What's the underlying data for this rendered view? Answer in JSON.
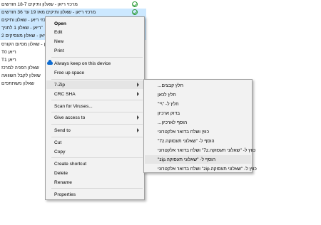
{
  "file_list": {
    "rows": [
      {
        "name": "מרכזי ריאן - שאלון ותיקים 18-7 חודשים",
        "selected": false,
        "synced": true
      },
      {
        "name": "מרכזי ריאן - שאלון ותיקים מאז 19 עד 36 חודשים",
        "selected": true,
        "synced": true
      },
      {
        "name": "מרכזי ריאן - שאלון ותיקים",
        "selected": true,
        "synced": false
      },
      {
        "name": "\"ריאן - שאלון 1 לחניך",
        "selected": true,
        "synced": false
      },
      {
        "name": "ריאן - שאלון מעסיקים 2",
        "selected": true,
        "synced": false
      },
      {
        "name": "ריאן - שאלון מסיום הקורס",
        "selected": false,
        "synced": false
      },
      {
        "name": "T0 ריאן",
        "selected": false,
        "synced": false
      },
      {
        "name": "T1 ריאן",
        "selected": false,
        "synced": false
      },
      {
        "name": "שאלון הפניה למרכז",
        "selected": false,
        "synced": false
      },
      {
        "name": "שאלון לקבל השוואה",
        "selected": false,
        "synced": false
      },
      {
        "name": "שאלון משתתפים",
        "selected": false,
        "synced": false
      }
    ]
  },
  "context_menu": {
    "open": "Open",
    "edit": "Edit",
    "new": "New",
    "print": "Print",
    "always_keep": "Always keep on this device",
    "free_up_space": "Free up space",
    "seven_zip": "7-Zip",
    "crc_sha": "CRC SHA",
    "scan_viruses": "Scan for Viruses...",
    "give_access": "Give access to",
    "send_to": "Send to",
    "cut": "Cut",
    "copy": "Copy",
    "create_shortcut": "Create shortcut",
    "delete": "Delete",
    "rename": "Rename",
    "properties": "Properties"
  },
  "submenu_7zip": {
    "items": [
      "חלץ קבצים...",
      "חלץ לכאן",
      "חלץ ל- \"\\*\"",
      "בדוק ארכיון",
      "הוסף לארכיון...",
      "כווץ ושלח בדואר אלקטרוני",
      "הוסף ל- \"שאלוני תעסוקה.7z\"",
      "כווץ ל- \"שאלוני תעסוקה.7z\" ושלח בדואר אלקטרוני",
      "הוסף ל- \"שאלוני תעסוקה.zip\"",
      "כווץ ל- \"שאלוני תעסוקה.zip\" ושלח בדואר אלקטרוני"
    ],
    "hovered_index": 8
  },
  "colors": {
    "selection": "#cce8ff",
    "menu_bg": "#f2f2f2",
    "hover_bg": "#e5e5e5",
    "onedrive_blue": "#0f6cd0",
    "sync_green": "#2e9d3a"
  },
  "icons": {
    "cloud": "onedrive-cloud-icon",
    "check": "sync-check-icon",
    "arrow": "submenu-arrow-icon"
  }
}
